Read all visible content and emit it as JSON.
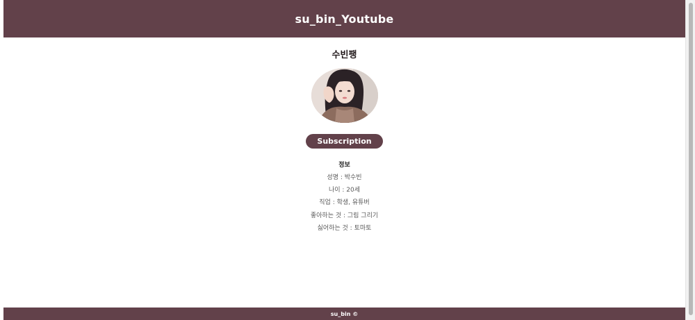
{
  "header": {
    "title": "su_bin_Youtube"
  },
  "profile": {
    "channel_name": "수빈팽",
    "avatar_icon": "profile-photo",
    "subscribe_label": "Subscription"
  },
  "info": {
    "title": "정보",
    "items": [
      "성명 : 박수빈",
      "나이 : 20세",
      "직업 : 학생, 유튜버",
      "좋아하는 것 : 그림 그리기",
      "싫어하는 것 : 토마토"
    ]
  },
  "footer": {
    "text": "su_bin ©"
  },
  "colors": {
    "brand": "#62414a",
    "background": "#ffffff"
  }
}
